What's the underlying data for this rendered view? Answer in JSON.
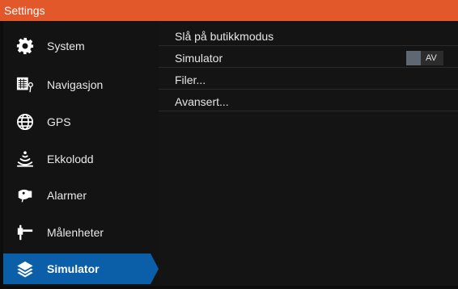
{
  "window": {
    "title": "Settings"
  },
  "sidebar": {
    "items": [
      {
        "label": "System",
        "icon": "gear-icon"
      },
      {
        "label": "Navigasjon",
        "icon": "navigation-chart-icon"
      },
      {
        "label": "GPS",
        "icon": "globe-icon"
      },
      {
        "label": "Ekkolodd",
        "icon": "sonar-icon"
      },
      {
        "label": "Alarmer",
        "icon": "alarm-horn-icon"
      },
      {
        "label": "Målenheter",
        "icon": "measuring-icon"
      },
      {
        "label": "Simulator",
        "icon": "layers-icon",
        "active": true
      }
    ],
    "active_color": "#0a5fa8"
  },
  "content": {
    "rows": [
      {
        "label": "Slå på butikkmodus"
      },
      {
        "label": "Simulator",
        "toggle": {
          "state": "AV",
          "on": false
        }
      },
      {
        "label": "Filer..."
      },
      {
        "label": "Avansert..."
      }
    ]
  },
  "colors": {
    "titlebar": "#e2582a",
    "toggle_knob": "#5d6873"
  }
}
